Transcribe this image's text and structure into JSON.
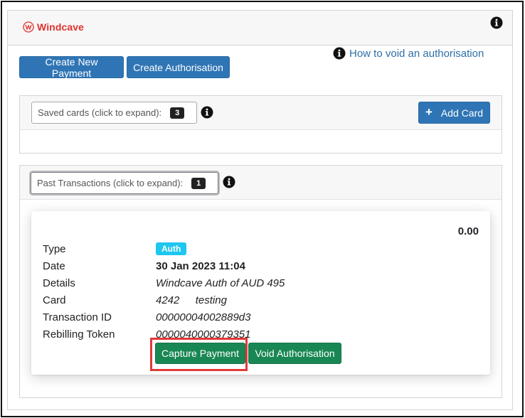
{
  "brand": {
    "name": "Windcave",
    "color": "#e0312f"
  },
  "header": {
    "info_icon": "info-circle-icon"
  },
  "toolbar": {
    "create_payment_label": "Create New Payment",
    "create_auth_label": "Create Authorisation",
    "howto_link": "How to void an authorisation"
  },
  "saved_cards": {
    "label": "Saved cards (click to expand):",
    "count": "3",
    "add_card_label": "Add Card"
  },
  "past_transactions": {
    "label": "Past Transactions (click to expand):",
    "count": "1"
  },
  "transaction": {
    "amount": "0.00",
    "labels": {
      "type": "Type",
      "date": "Date",
      "details": "Details",
      "card": "Card",
      "transaction_id": "Transaction ID",
      "rebilling_token": "Rebilling Token"
    },
    "type_badge": "Auth",
    "date": "30 Jan 2023 11:04",
    "details": "Windcave Auth of AUD 495",
    "card_number": "4242",
    "card_name": "testing",
    "transaction_id": "00000004002889d3",
    "rebilling_token": "0000040000379351",
    "capture_label": "Capture Payment",
    "void_label": "Void Authorisation"
  },
  "colors": {
    "primary": "#2f75b5",
    "success": "#198754",
    "badge": "#1ec6f0",
    "highlight": "#e03a3a"
  }
}
